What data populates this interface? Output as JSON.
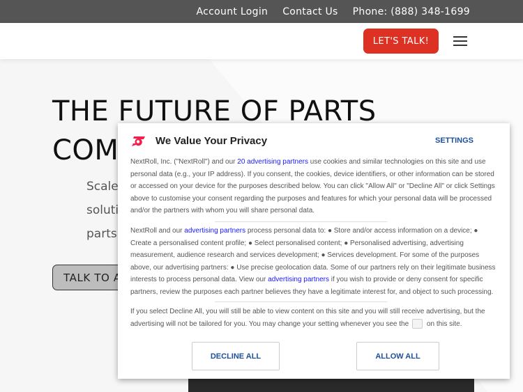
{
  "topbar": {
    "links": [
      "Account Login",
      "Contact Us",
      "Phone: (888) 348-1699"
    ]
  },
  "nav": {
    "cta": "LET'S TALK!",
    "menu_icon": "hamburger-icon"
  },
  "hero": {
    "title_line1": "THE FUTURE OF PARTS",
    "title_line2": "COM",
    "sub_lines": [
      "Scale",
      "soluti",
      "parts."
    ],
    "button": "TALK TO AN"
  },
  "consent": {
    "title": "We Value Your Privacy",
    "settings": "SETTINGS",
    "p1_a": "NextRoll, Inc. (\"NextRoll\") and our ",
    "p1_link": "20 advertising partners",
    "p1_b": " use cookies and similar technologies on this site and use personal data (e.g., your IP address). If you consent, the cookies, device identifiers, or other information can be stored or accessed on your device for the purposes described below. You can click \"Allow All\" or \"Decline All\" or click Settings above to customise your consent regarding the purposes and features for which your personal data will be processed and/or the partners with whom you will share personal data.",
    "p2_a": "NextRoll and our ",
    "p2_link1": "advertising partners",
    "p2_b": " process personal data to: ● Store and/or access information on a device; ● Create a personalised content profile; ● Select personalised content; ● Personalised advertising, advertising measurement, audience research and services development; ● Services development. For some of the purposes above, our advertising partners: ● Use precise geolocation data. Some of our partners rely on their legitimate business interests to process personal data. View our ",
    "p2_link2": "advertising partners",
    "p2_c": " if you wish to provide or deny consent for specific partners, review the purposes each partner believes they have a legitimate interest for, and object to such processing.",
    "p3_a": "If you select Decline All, you will still be able to view content on this site and you will still receive advertising, but the advertising will not be tailored for you. You may change your setting whenever you see the",
    "p3_b": "on this site.",
    "decline": "DECLINE ALL",
    "allow": "ALLOW ALL",
    "colors": {
      "brand": "#f0224d",
      "link": "#1a1aff",
      "button_text": "#1c4f9c",
      "cta": "#dd3124"
    }
  }
}
